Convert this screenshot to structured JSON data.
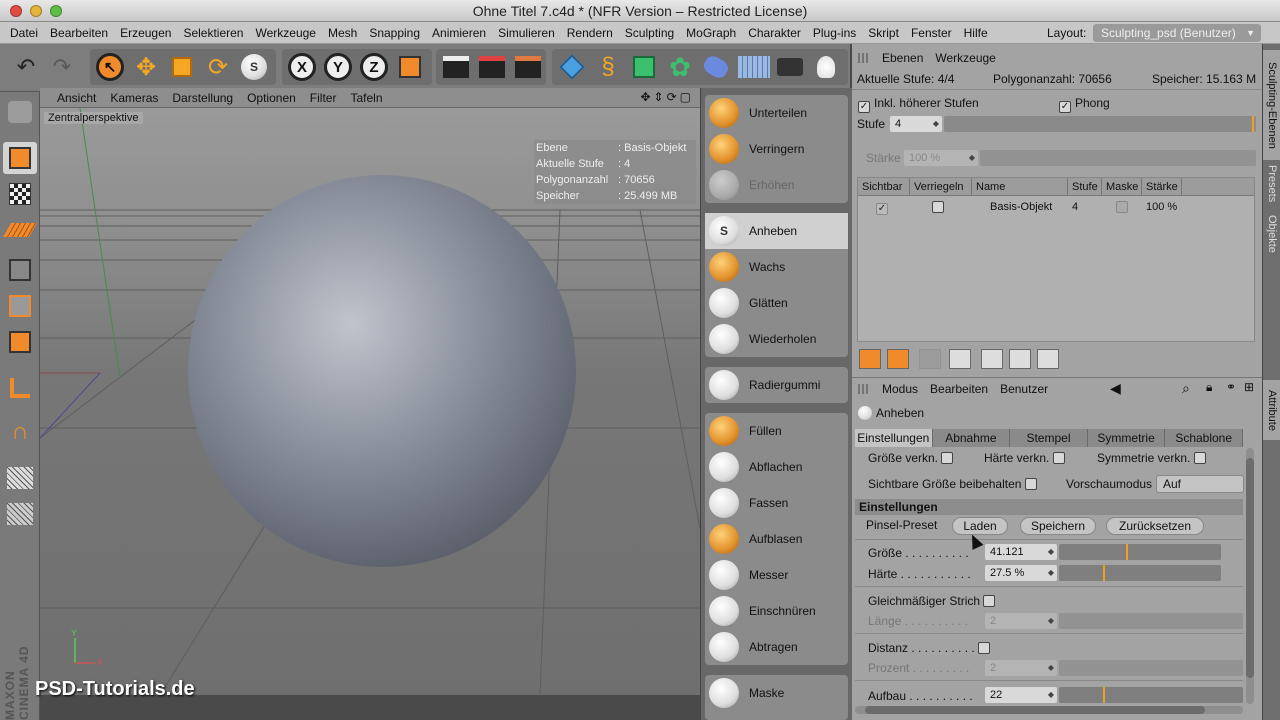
{
  "window": {
    "title": "Ohne Titel 7.c4d * (NFR Version – Restricted License)"
  },
  "menu": [
    "Datei",
    "Bearbeiten",
    "Erzeugen",
    "Selektieren",
    "Werkzeuge",
    "Mesh",
    "Snapping",
    "Animieren",
    "Simulieren",
    "Rendern",
    "Sculpting",
    "MoGraph",
    "Charakter",
    "Plug-ins",
    "Skript",
    "Fenster",
    "Hilfe"
  ],
  "layout": {
    "label": "Layout:",
    "value": "Sculpting_psd (Benutzer)"
  },
  "viewport": {
    "menu": [
      "Ansicht",
      "Kameras",
      "Darstellung",
      "Optionen",
      "Filter",
      "Tafeln"
    ],
    "camera_label": "Zentralperspektive",
    "hud": [
      {
        "k": "Ebene",
        "v": "Basis-Objekt"
      },
      {
        "k": "Aktuelle Stufe",
        "v": "4"
      },
      {
        "k": "Polygonanzahl",
        "v": "70656"
      },
      {
        "k": "Speicher",
        "v": "25.499 MB"
      }
    ],
    "axis_x": "X",
    "axis_y": "Y",
    "watermark": "PSD-Tutorials.de",
    "maxon_watermark": "MAXON CINEMA 4D"
  },
  "brushes": {
    "group1": [
      "Unterteilen",
      "Verringern",
      "Erhöhen"
    ],
    "group2": [
      "Anheben",
      "Wachs",
      "Glätten",
      "Wiederholen"
    ],
    "group3": [
      "Radiergummi"
    ],
    "group4": [
      "Füllen",
      "Abflachen",
      "Fassen",
      "Aufblasen",
      "Messer",
      "Einschnüren",
      "Abtragen"
    ],
    "group5": [
      "Maske"
    ],
    "selected": "Anheben"
  },
  "layers": {
    "tabs": [
      "Ebenen",
      "Werkzeuge"
    ],
    "current_level": "Aktuelle Stufe: 4/4",
    "poly_count": "Polygonanzahl: 70656",
    "memory": "Speicher: 15.163 M",
    "incl_higher": "Inkl. höherer Stufen",
    "phong": "Phong",
    "stufe_label": "Stufe",
    "stufe_value": "4",
    "staerke_label": "Stärke",
    "staerke_value": "100 %",
    "columns": [
      "Sichtbar",
      "Verriegeln",
      "Name",
      "Stufe",
      "Maske",
      "Stärke"
    ],
    "row": {
      "name": "Basis-Objekt",
      "stufe": "4",
      "staerke": "100 %"
    }
  },
  "attributes": {
    "menu": [
      "Modus",
      "Bearbeiten",
      "Benutzer"
    ],
    "tool_name": "Anheben",
    "tabs": [
      "Einstellungen",
      "Abnahme",
      "Stempel",
      "Symmetrie",
      "Schablone"
    ],
    "groesse_verkn": "Größe verkn.",
    "haerte_verkn": "Härte verkn.",
    "symmetrie_verkn": "Symmetrie verkn.",
    "sichtbare_groesse": "Sichtbare Größe beibehalten",
    "vorschaumodus": "Vorschaumodus",
    "vorschau_value": "Auf Oberfläche",
    "section": "Einstellungen",
    "pinsel_preset": "Pinsel-Preset",
    "btn_laden": "Laden",
    "btn_speichern": "Speichern",
    "btn_zuruecksetzen": "Zurücksetzen",
    "groesse_label": "Größe . . . . . . . . . .",
    "groesse_value": "41.121",
    "haerte_label": "Härte . . . . . . . . . . .",
    "haerte_value": "27.5 %",
    "gleich_strich": "Gleichmäßiger Strich",
    "laenge_label": "Länge . . . . . . . . . .",
    "laenge_value": "2",
    "distanz": "Distanz . . . . . . . . . .",
    "prozent_label": "Prozent . . . . . . . . .",
    "prozent_value": "2",
    "aufbau_label": "Aufbau . . . . . . . . . .",
    "aufbau_value": "22"
  },
  "side_tabs": [
    "Sculpting-Ebenen",
    "Presets",
    "Objekte",
    "Attribute"
  ],
  "colors": {
    "accent_orange": "#f0a020",
    "panel": "#a3a3a3"
  }
}
